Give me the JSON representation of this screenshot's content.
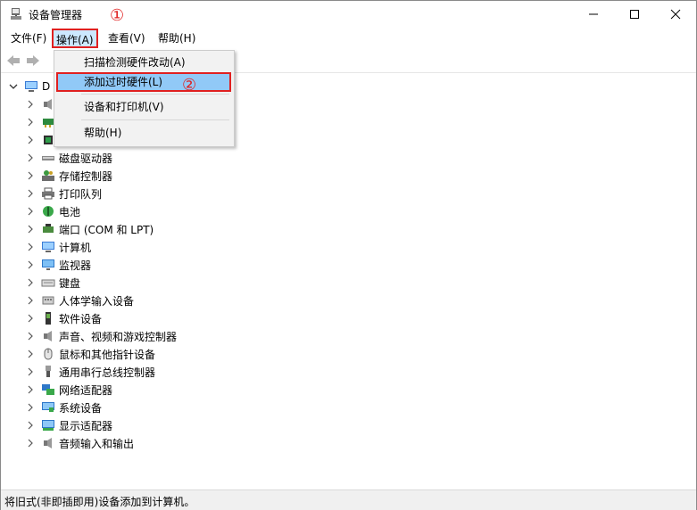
{
  "window": {
    "title": "设备管理器",
    "icon": "device-manager-icon"
  },
  "menubar": {
    "file": "文件(F)",
    "action": "操作(A)",
    "view": "查看(V)",
    "help": "帮助(H)"
  },
  "tree": {
    "root_label": "D",
    "items": [
      {
        "label": "",
        "icon": "audio-io-icon"
      },
      {
        "label": "",
        "icon": "network-card-icon"
      },
      {
        "label": "",
        "icon": "processor-icon"
      },
      {
        "label": "磁盘驱动器",
        "icon": "disk-drive-icon"
      },
      {
        "label": "存储控制器",
        "icon": "storage-controller-icon"
      },
      {
        "label": "打印队列",
        "icon": "printer-icon"
      },
      {
        "label": "电池",
        "icon": "battery-icon"
      },
      {
        "label": "端口 (COM 和 LPT)",
        "icon": "port-icon"
      },
      {
        "label": "计算机",
        "icon": "computer-icon"
      },
      {
        "label": "监视器",
        "icon": "monitor-icon"
      },
      {
        "label": "键盘",
        "icon": "keyboard-icon"
      },
      {
        "label": "人体学输入设备",
        "icon": "hid-icon"
      },
      {
        "label": "软件设备",
        "icon": "software-device-icon"
      },
      {
        "label": "声音、视频和游戏控制器",
        "icon": "speaker-icon"
      },
      {
        "label": "鼠标和其他指针设备",
        "icon": "mouse-icon"
      },
      {
        "label": "通用串行总线控制器",
        "icon": "usb-icon"
      },
      {
        "label": "网络适配器",
        "icon": "network-adapter-icon"
      },
      {
        "label": "系统设备",
        "icon": "system-device-icon"
      },
      {
        "label": "显示适配器",
        "icon": "display-adapter-icon"
      },
      {
        "label": "音频输入和输出",
        "icon": "audio-io-icon"
      }
    ]
  },
  "dropdown": {
    "scan": "扫描检测硬件改动(A)",
    "add_legacy": "添加过时硬件(L)",
    "printers": "设备和打印机(V)",
    "help": "帮助(H)"
  },
  "annotations": {
    "step1": "①",
    "step2": "②"
  },
  "statusbar": {
    "text": "将旧式(非即插即用)设备添加到计算机。"
  },
  "colors": {
    "highlight": "#91c9f7",
    "menu_active": "#cce8ff",
    "annotation_red": "#e02020"
  }
}
